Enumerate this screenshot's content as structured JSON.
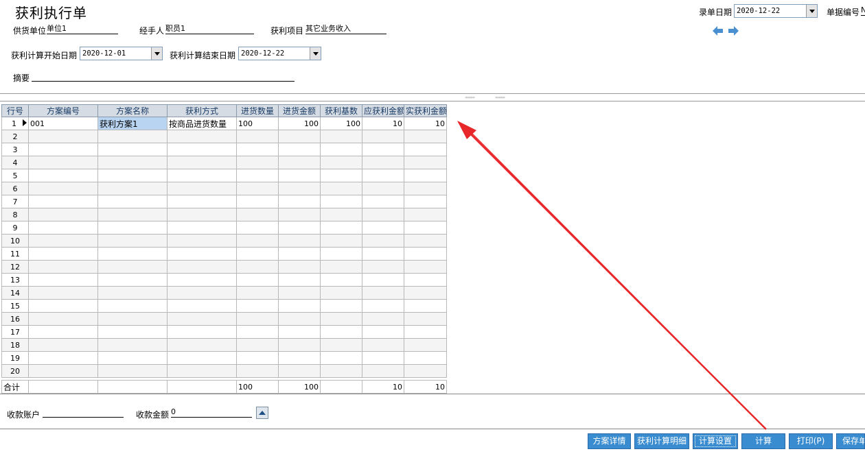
{
  "window": {
    "title": "获利执行单"
  },
  "header": {
    "entry_date_label": "录单日期",
    "entry_date_value": "2020-12-22",
    "doc_no_label": "单据编号",
    "doc_no_value": "N",
    "supplier_label": "供货单位",
    "supplier_value": "单位1",
    "handler_label": "经手人",
    "handler_value": "职员1",
    "profit_item_label": "获利项目",
    "profit_item_value": "其它业务收入",
    "start_date_label": "获利计算开始日期",
    "start_date_value": "2020-12-01",
    "end_date_label": "获利计算结束日期",
    "end_date_value": "2020-12-22",
    "summary_label": "摘要",
    "summary_value": ""
  },
  "nav_icons": [
    "arrow-left-icon",
    "arrow-right-icon"
  ],
  "grid": {
    "columns": [
      "行号",
      "方案编号",
      "方案名称",
      "获利方式",
      "进货数量",
      "进货金额",
      "获利基数",
      "应获利金额",
      "实获利金额"
    ],
    "rows": [
      {
        "no": "1",
        "scheme_code": "001",
        "scheme_name": "获利方案1",
        "method": "按商品进货数量",
        "qty": "100",
        "amount": "100",
        "base": "100",
        "due": "10",
        "actual": "10"
      },
      {
        "no": "2"
      },
      {
        "no": "3"
      },
      {
        "no": "4"
      },
      {
        "no": "5"
      },
      {
        "no": "6"
      },
      {
        "no": "7"
      },
      {
        "no": "8"
      },
      {
        "no": "9"
      },
      {
        "no": "10"
      },
      {
        "no": "11"
      },
      {
        "no": "12"
      },
      {
        "no": "13"
      },
      {
        "no": "14"
      },
      {
        "no": "15"
      },
      {
        "no": "16"
      },
      {
        "no": "17"
      },
      {
        "no": "18"
      },
      {
        "no": "19"
      },
      {
        "no": "20"
      }
    ],
    "totals": {
      "label": "合计",
      "qty": "100",
      "amount": "100",
      "due": "10",
      "actual": "10"
    }
  },
  "footer": {
    "account_label": "收款账户",
    "account_value": "",
    "amount_label": "收款金额",
    "amount_value": "0"
  },
  "buttons": {
    "scheme_detail": "方案详情",
    "profit_detail": "获利计算明细",
    "calc_settings": "计算设置",
    "calculate": "计算",
    "print": "打印(P)",
    "save": "保存单"
  },
  "colors": {
    "button_bg": "#3a8cd0",
    "header_bg": "#d6dce4",
    "selected_cell": "#b8d4f0",
    "annotation_arrow": "#e8272a"
  }
}
